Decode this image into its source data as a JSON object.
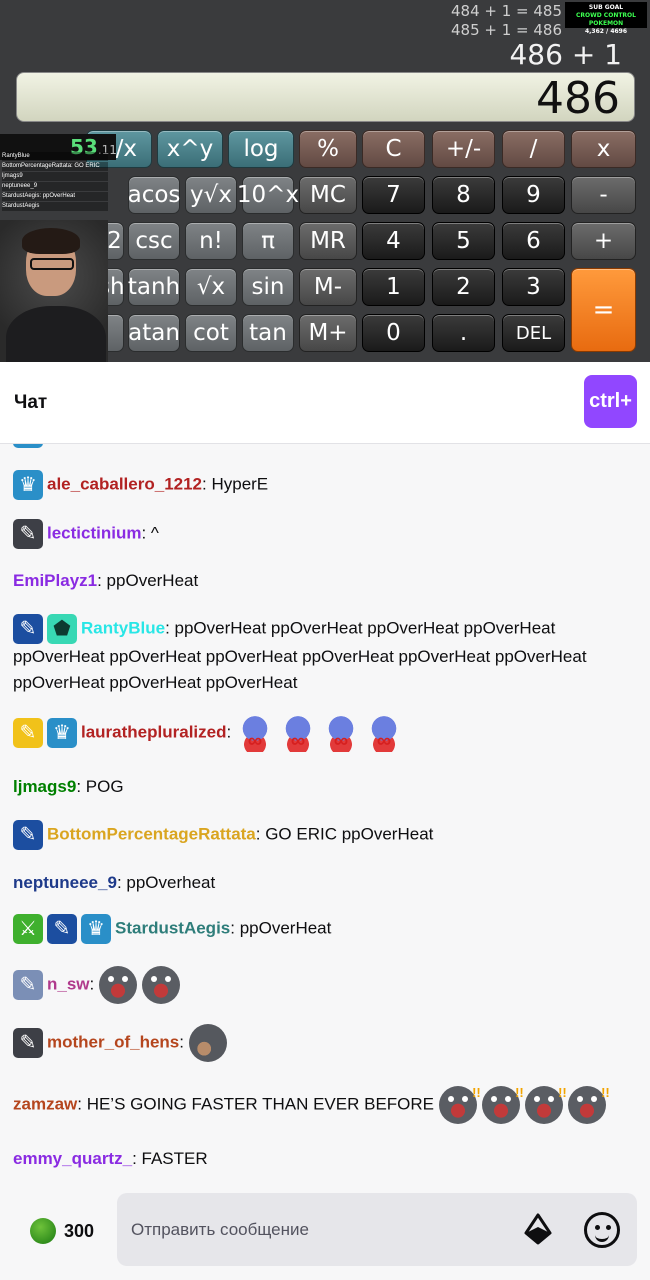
{
  "stream": {
    "history": [
      "484 + 1 = 485",
      "485 + 1 = 486"
    ],
    "sub_goal": {
      "line1": "SUB GOAL",
      "line2": "CROWD CONTROL POKEMON",
      "line3": "4,362 / 4696"
    },
    "expression": "486 + 1",
    "display_value": "486",
    "timer": {
      "main": "53",
      "fraction": ".11"
    },
    "overlay_chat": [
      "RantyBlue",
      "BottomPercentageRattata: GO ERIC",
      "ljmags9",
      "neptuneee_9",
      "StardustAegis: ppOverHeat",
      "StardustAegis"
    ],
    "keys": {
      "row1": [
        "1/x",
        "x^y",
        "log",
        "%",
        "C",
        "+/-",
        "/",
        "x"
      ],
      "row2": [
        "acos",
        "y√x",
        "10^x",
        "MC",
        "7",
        "8",
        "9",
        "-"
      ],
      "row3": [
        "x^2",
        "csc",
        "n!",
        "π",
        "MR",
        "4",
        "5",
        "6",
        "+"
      ],
      "row4": [
        "cosh",
        "tanh",
        "√x",
        "sin",
        "M-",
        "1",
        "2",
        "3"
      ],
      "row5": [
        "in",
        "atan",
        "cot",
        "tan",
        "M+",
        "0",
        ".",
        "DEL"
      ],
      "equals": "="
    }
  },
  "chat": {
    "title": "Чат",
    "ctrl_button": "ctrl+",
    "messages": [
      {
        "user": "ale_caballero_1212",
        "color": "#b22222",
        "text": ": HyperE",
        "badges": [
          "crown-badge"
        ]
      },
      {
        "user": "lectictinium",
        "color": "#8a2be2",
        "text": ": ^",
        "badges": [
          "feather-badge"
        ]
      },
      {
        "user": "EmiPlayz1",
        "color": "#8a2be2",
        "text": ": ppOverHeat",
        "badges": []
      },
      {
        "user": "RantyBlue",
        "color": "#28e6e6",
        "text": ": ppOverHeat ppOverHeat ppOverHeat ppOverHeat ppOverHeat ppOverHeat ppOverHeat ppOverHeat ppOverHeat ppOverHeat ppOverHeat ppOverHeat ppOverHeat",
        "badges": [
          "feather-badge",
          "pentagon-badge"
        ]
      },
      {
        "user": "laurathepluralized",
        "color": "#b22222",
        "text": ":",
        "badges": [
          "feather-badge",
          "crown-badge"
        ]
      },
      {
        "user": "ljmags9",
        "color": "#008000",
        "text": ": POG",
        "badges": []
      },
      {
        "user": "BottomPercentageRattata",
        "color": "#daa520",
        "text": ": GO ERIC ppOverHeat",
        "badges": [
          "feather-badge"
        ]
      },
      {
        "user": "neptuneee_9",
        "color": "#1e3a8a",
        "text": ": ppOverheat",
        "badges": []
      },
      {
        "user": "StardustAegis",
        "color": "#2e7d7a",
        "text": ": ppOverHeat",
        "badges": [
          "sword-badge",
          "feather-badge",
          "crown-badge"
        ]
      },
      {
        "user": "n_sw",
        "color": "#b03a8c",
        "text": ":",
        "badges": [
          "feather-badge"
        ]
      },
      {
        "user": "mother_of_hens",
        "color": "#b5461e",
        "text": ":",
        "badges": [
          "feather-badge"
        ]
      },
      {
        "user": "zamzaw",
        "color": "#b5461e",
        "text": ": HE’S GOING FASTER THAN EVER BEFORE",
        "badges": []
      },
      {
        "user": "emmy_quartz_",
        "color": "#8a2be2",
        "text": ": FASTER",
        "badges": []
      }
    ]
  },
  "input": {
    "points": "300",
    "placeholder": "Отправить сообщение"
  }
}
